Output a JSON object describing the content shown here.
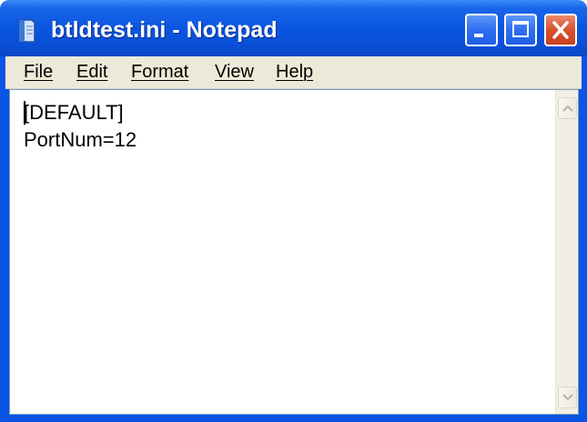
{
  "window": {
    "title": "btldtest.ini - Notepad",
    "app_icon": "notepad-icon"
  },
  "caption_buttons": {
    "minimize": "minimize-icon",
    "maximize": "maximize-icon",
    "close": "close-icon"
  },
  "menu": {
    "items": [
      "File",
      "Edit",
      "Format",
      "View",
      "Help"
    ]
  },
  "editor": {
    "lines": [
      "[DEFAULT]",
      "PortNum=12"
    ]
  },
  "scrollbar": {
    "up": "scroll-up-arrow-icon",
    "down": "scroll-down-arrow-icon"
  },
  "colors": {
    "titlebar": "#0a55e6",
    "close_button": "#d8512f",
    "menubar": "#ece9d8",
    "editor_background": "#ffffff"
  }
}
